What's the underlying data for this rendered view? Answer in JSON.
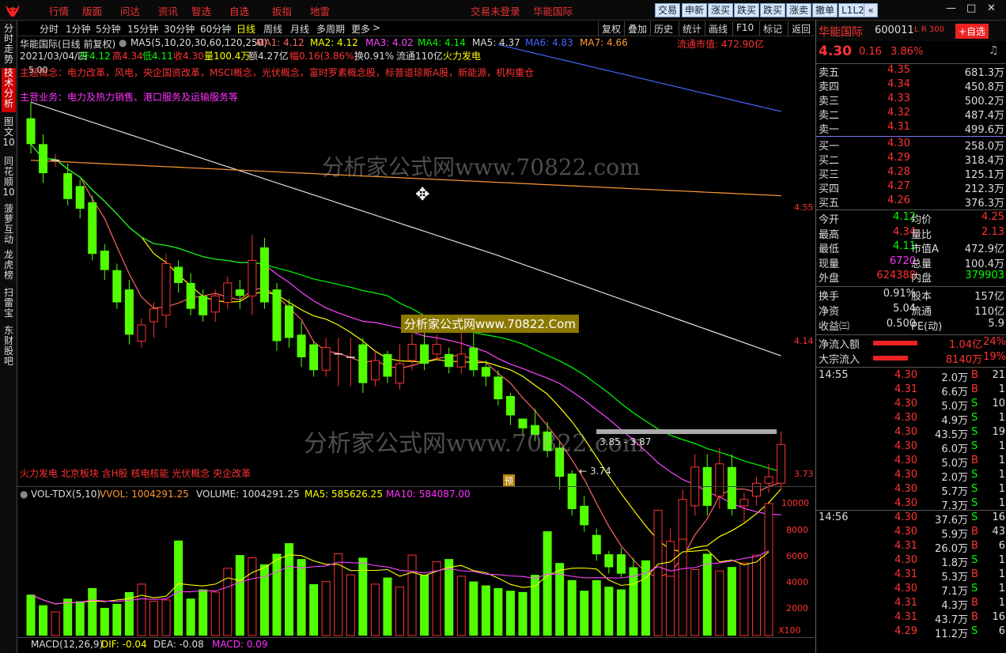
{
  "menu": [
    "行情",
    "版面",
    "问达",
    "资讯",
    "智选",
    "自选",
    "扳指",
    "地雷"
  ],
  "menu_status": {
    "login": "交易未登录",
    "stock": "华能国际"
  },
  "right_buttons": [
    "交易",
    "申新",
    "涨买",
    "跌买",
    "跌买",
    "涨卖",
    "撤单",
    "L1L2",
    "«"
  ],
  "window_controls": [
    "—",
    "□",
    "✕"
  ],
  "left_tabs": [
    "分时走势",
    "技术分析",
    "图文10",
    "同花顺10",
    "菠萝互动",
    "龙虎榜",
    "扫雷宝",
    "东财股吧"
  ],
  "periods": [
    "分时",
    "1分钟",
    "5分钟",
    "15分钟",
    "30分钟",
    "60分钟",
    "日线",
    "周线",
    "月线",
    "多周期",
    "更多"
  ],
  "active_period": "日线",
  "tools": [
    "复权",
    "叠加",
    "历史",
    "统计",
    "画线",
    "F10",
    "标记",
    "返回"
  ],
  "info": {
    "name": "华能国际(日线 前复权)",
    "ma_params": "MA5(5,10,20,30,60,120,250)",
    "ma": [
      {
        "label": "MA1: 4.12",
        "arrow": "↑",
        "color": "#ff6666"
      },
      {
        "label": "MA2: 4.12",
        "arrow": "↑",
        "color": "#ffff00"
      },
      {
        "label": "MA3: 4.02",
        "arrow": "↑",
        "color": "#ff44ff"
      },
      {
        "label": "MA4: 4.14",
        "arrow": "↓",
        "color": "#00ff00"
      },
      {
        "label": "MA5: 4.37",
        "arrow": "↓",
        "color": "#dddddd"
      },
      {
        "label": "MA6: 4.83",
        "arrow": "↓",
        "color": "#4466ff"
      },
      {
        "label": "MA7: 4.66",
        "arrow": "↓",
        "color": "#ff9933"
      }
    ],
    "float_mv": "流通市值: 472.90亿",
    "date": "2021/03/04/四",
    "open": "开4.12",
    "high": "高4.34",
    "low": "低4.11",
    "close": "收4.30",
    "vol": "量100.4万",
    "amt": "额4.27亿",
    "chg": "幅0.16(3.86%)",
    "turn": "换0.91%",
    "float": "流通110亿",
    "tag": "火力发电"
  },
  "concepts": "主题概念：电力改革，风电，央企国资改革，MSCI概念，光伏概念，富时罗素概念股，标普道琼斯A股，新能源，机构重仓",
  "main_biz": "主营业务：电力及热力销售、港口服务及运输服务等",
  "watermark": "分析家公式网www.70822.com",
  "watermark_box": "分析家公式网www.70822.Com",
  "price_marks": {
    "p500": "5.00",
    "range": "3.85 - 3.87",
    "low": "3.74",
    "axis": [
      "4.55",
      "4.14",
      "3.73"
    ]
  },
  "sectors": "火力发电 北京板块 含H股 核电核能 光伏概念 央企改革",
  "pred_tag": "预",
  "vol_legend": {
    "name": "VOL-TDX(5,10)",
    "vvol": "VVOL: 1004291.25",
    "volume": "VOLUME: 1004291.25",
    "ma5": "MA5: 585626.25",
    "ma10": "MA10: 584087.00"
  },
  "vol_axis": [
    "10000",
    "8000",
    "6000",
    "4000",
    "2000",
    "X100"
  ],
  "macd": {
    "name": "MACD(12,26,9)",
    "dif": "DIF: -0.04",
    "dea": "DEA: -0.08",
    "macd": "MACD: 0.09"
  },
  "chart_data": {
    "type": "candlestick",
    "ylim": [
      3.73,
      5.0
    ],
    "candles": [
      {
        "o": 4.83,
        "c": 4.75,
        "h": 4.88,
        "l": 4.72
      },
      {
        "o": 4.75,
        "c": 4.66,
        "h": 4.78,
        "l": 4.63
      },
      {
        "o": 4.7,
        "c": 4.7,
        "h": 4.72,
        "l": 4.68
      },
      {
        "o": 4.66,
        "c": 4.58,
        "h": 4.69,
        "l": 4.56
      },
      {
        "o": 4.62,
        "c": 4.55,
        "h": 4.64,
        "l": 4.52
      },
      {
        "o": 4.57,
        "c": 4.41,
        "h": 4.59,
        "l": 4.39
      },
      {
        "o": 4.42,
        "c": 4.36,
        "h": 4.44,
        "l": 4.33
      },
      {
        "o": 4.36,
        "c": 4.26,
        "h": 4.38,
        "l": 4.24
      },
      {
        "o": 4.3,
        "c": 4.16,
        "h": 4.33,
        "l": 4.13
      },
      {
        "o": 4.14,
        "c": 4.19,
        "h": 4.21,
        "l": 4.12
      },
      {
        "o": 4.2,
        "c": 4.24,
        "h": 4.26,
        "l": 4.15
      },
      {
        "o": 4.22,
        "c": 4.38,
        "h": 4.41,
        "l": 4.18
      },
      {
        "o": 4.37,
        "c": 4.32,
        "h": 4.39,
        "l": 4.29
      },
      {
        "o": 4.32,
        "c": 4.24,
        "h": 4.35,
        "l": 4.22
      },
      {
        "o": 4.28,
        "c": 4.22,
        "h": 4.3,
        "l": 4.2
      },
      {
        "o": 4.23,
        "c": 4.28,
        "h": 4.3,
        "l": 4.2
      },
      {
        "o": 4.26,
        "c": 4.32,
        "h": 4.34,
        "l": 4.24
      },
      {
        "o": 4.3,
        "c": 4.28,
        "h": 4.33,
        "l": 4.24
      },
      {
        "o": 4.28,
        "c": 4.39,
        "h": 4.47,
        "l": 4.22
      },
      {
        "o": 4.43,
        "c": 4.26,
        "h": 4.46,
        "l": 4.24
      },
      {
        "o": 4.3,
        "c": 4.14,
        "h": 4.32,
        "l": 4.11
      },
      {
        "o": 4.25,
        "c": 4.15,
        "h": 4.27,
        "l": 4.12
      },
      {
        "o": 4.16,
        "c": 4.09,
        "h": 4.2,
        "l": 4.06
      },
      {
        "o": 4.13,
        "c": 4.05,
        "h": 4.14,
        "l": 4.03
      },
      {
        "o": 4.05,
        "c": 4.12,
        "h": 4.15,
        "l": 4.03
      },
      {
        "o": 4.1,
        "c": 4.1,
        "h": 4.15,
        "l": 4.0
      },
      {
        "o": 4.09,
        "c": 4.09,
        "h": 4.15,
        "l": 4.0
      },
      {
        "o": 4.13,
        "c": 4.01,
        "h": 4.15,
        "l": 3.98
      },
      {
        "o": 4.02,
        "c": 4.08,
        "h": 4.11,
        "l": 4.0
      },
      {
        "o": 4.1,
        "c": 4.03,
        "h": 4.11,
        "l": 4.01
      },
      {
        "o": 4.01,
        "c": 4.07,
        "h": 4.13,
        "l": 3.99
      },
      {
        "o": 4.08,
        "c": 4.13,
        "h": 4.18,
        "l": 4.05
      },
      {
        "o": 4.13,
        "c": 4.07,
        "h": 4.18,
        "l": 4.05
      },
      {
        "o": 4.1,
        "c": 4.13,
        "h": 4.16,
        "l": 4.08
      },
      {
        "o": 4.1,
        "c": 4.06,
        "h": 4.12,
        "l": 4.04
      },
      {
        "o": 4.06,
        "c": 4.1,
        "h": 4.22,
        "l": 4.04
      },
      {
        "o": 4.12,
        "c": 4.05,
        "h": 4.18,
        "l": 4.03
      },
      {
        "o": 4.06,
        "c": 4.03,
        "h": 4.08,
        "l": 4.0
      },
      {
        "o": 4.03,
        "c": 3.96,
        "h": 4.05,
        "l": 3.94
      },
      {
        "o": 3.97,
        "c": 3.91,
        "h": 3.98,
        "l": 3.88
      },
      {
        "o": 3.9,
        "c": 3.87,
        "h": 3.9,
        "l": 3.85
      },
      {
        "o": 3.88,
        "c": 3.85,
        "h": 3.93,
        "l": 3.83
      },
      {
        "o": 3.86,
        "c": 3.8,
        "h": 3.89,
        "l": 3.78
      },
      {
        "o": 3.81,
        "c": 3.72,
        "h": 3.83,
        "l": 3.68
      },
      {
        "o": 3.73,
        "c": 3.62,
        "h": 3.74,
        "l": 3.6
      },
      {
        "o": 3.63,
        "c": 3.57,
        "h": 3.66,
        "l": 3.55
      },
      {
        "o": 3.54,
        "c": 3.48,
        "h": 3.56,
        "l": 3.46
      },
      {
        "o": 3.48,
        "c": 3.44,
        "h": 3.49,
        "l": 3.42
      },
      {
        "o": 3.48,
        "c": 3.42,
        "h": 3.5,
        "l": 3.41
      },
      {
        "o": 3.44,
        "c": 3.4,
        "h": 3.47,
        "l": 3.38
      },
      {
        "o": 3.4,
        "c": 3.38,
        "h": 3.41,
        "l": 3.37
      },
      {
        "o": 3.38,
        "c": 3.4,
        "h": 3.42,
        "l": 3.37
      },
      {
        "o": 3.4,
        "c": 3.52,
        "h": 3.56,
        "l": 3.39
      },
      {
        "o": 3.52,
        "c": 3.65,
        "h": 3.68,
        "l": 3.48
      },
      {
        "o": 3.63,
        "c": 3.75,
        "h": 3.79,
        "l": 3.6
      },
      {
        "o": 3.75,
        "c": 3.63,
        "h": 3.79,
        "l": 3.6
      },
      {
        "o": 3.66,
        "c": 3.76,
        "h": 3.81,
        "l": 3.62
      },
      {
        "o": 3.75,
        "c": 3.62,
        "h": 3.79,
        "l": 3.6
      },
      {
        "o": 3.63,
        "c": 3.65,
        "h": 3.67,
        "l": 3.58
      },
      {
        "o": 3.66,
        "c": 3.7,
        "h": 3.72,
        "l": 3.63
      },
      {
        "o": 3.7,
        "c": 3.72,
        "h": 3.76,
        "l": 3.67
      },
      {
        "o": 3.7,
        "c": 3.82,
        "h": 3.86,
        "l": 3.68
      }
    ],
    "volumes": [
      3100,
      2300,
      1800,
      2800,
      2600,
      3600,
      2100,
      2400,
      3300,
      3900,
      2600,
      2700,
      7200,
      2800,
      3500,
      3300,
      5100,
      6100,
      5900,
      5400,
      6200,
      7000,
      5800,
      3900,
      4100,
      6200,
      4600,
      5900,
      3900,
      4400,
      3700,
      6100,
      4600,
      5600,
      5800,
      4500,
      4100,
      3800,
      3600,
      3400,
      3300,
      4600,
      7900,
      5500,
      4200,
      3400,
      4200,
      3700,
      3500,
      4700,
      5700,
      9500,
      4500,
      7300,
      5000,
      6200,
      4900,
      5200,
      5500,
      6100,
      10000
    ],
    "price_axis_labels": [
      "4.55",
      "4.14",
      "3.73"
    ],
    "volume_axis_labels": [
      "10000",
      "8000",
      "6000",
      "4000",
      "2000",
      "X100"
    ]
  },
  "quote": {
    "name": "华能国际",
    "code": "600011",
    "lr": "L R 300",
    "add": "+自选",
    "price": "4.30",
    "chg": "0.16",
    "pct": "3.86%",
    "asks": [
      [
        "卖五",
        "4.35",
        "681.3万"
      ],
      [
        "卖四",
        "4.34",
        "450.8万"
      ],
      [
        "卖三",
        "4.33",
        "500.2万"
      ],
      [
        "卖二",
        "4.32",
        "487.4万"
      ],
      [
        "卖一",
        "4.31",
        "499.6万"
      ]
    ],
    "bids": [
      [
        "买一",
        "4.30",
        "258.0万"
      ],
      [
        "买二",
        "4.29",
        "318.4万"
      ],
      [
        "买三",
        "4.28",
        "125.1万"
      ],
      [
        "买四",
        "4.27",
        "212.3万"
      ],
      [
        "买五",
        "4.26",
        "376.3万"
      ]
    ],
    "stats": [
      [
        "今开",
        "4.12",
        "均价",
        "4.25"
      ],
      [
        "最高",
        "4.34",
        "量比",
        "2.13"
      ],
      [
        "最低",
        "4.11",
        "市值A",
        "472.9亿"
      ],
      [
        "现量",
        "6720",
        "总量",
        "100.4万"
      ],
      [
        "外盘",
        "624388",
        "内盘",
        "379903"
      ]
    ],
    "stats2": [
      [
        "换手",
        "0.91%",
        "股本",
        "157亿"
      ],
      [
        "净资",
        "5.04",
        "流通",
        "110亿"
      ],
      [
        "收益㈢",
        "0.500",
        "PE(动)",
        "5.9"
      ]
    ],
    "flows": [
      [
        "净流入额",
        "1.04亿",
        "24%"
      ],
      [
        "大宗流入",
        "8140万",
        "19%"
      ]
    ],
    "ticks1_time": "14:55",
    "ticks1": [
      [
        "4.30",
        "2.0万",
        "B",
        "21"
      ],
      [
        "4.31",
        "6.6万",
        "B",
        "1"
      ],
      [
        "4.30",
        "5.0万",
        "S",
        "10"
      ],
      [
        "4.30",
        "4.9万",
        "S",
        "1"
      ],
      [
        "4.30",
        "43.5万",
        "S",
        "19"
      ],
      [
        "4.30",
        "6.0万",
        "S",
        "1"
      ],
      [
        "4.30",
        "5.0万",
        "B",
        "1"
      ],
      [
        "4.30",
        "2.0万",
        "S",
        "1"
      ],
      [
        "4.30",
        "5.7万",
        "S",
        "1"
      ],
      [
        "4.30",
        "7.3万",
        "S",
        "1"
      ]
    ],
    "ticks2_time": "14:56",
    "ticks2": [
      [
        "4.30",
        "37.6万",
        "S",
        "16"
      ],
      [
        "4.30",
        "5.9万",
        "B",
        "43"
      ],
      [
        "4.31",
        "26.0万",
        "B",
        "6"
      ],
      [
        "4.30",
        "1.8万",
        "S",
        "1"
      ],
      [
        "4.31",
        "5.3万",
        "B",
        "1"
      ],
      [
        "4.30",
        "7.1万",
        "S",
        "1"
      ],
      [
        "4.31",
        "4.3万",
        "B",
        "1"
      ],
      [
        "4.31",
        "43.7万",
        "B",
        "16"
      ],
      [
        "4.29",
        "11.2万",
        "S",
        "6"
      ]
    ]
  }
}
